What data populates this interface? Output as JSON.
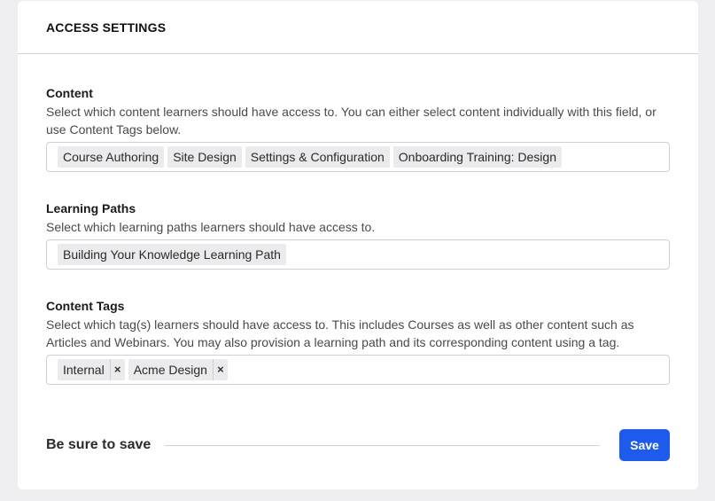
{
  "card": {
    "title": "ACCESS SETTINGS"
  },
  "content": {
    "title": "Content",
    "description": "Select which content learners should have access to. You can either select content individually with this field, or use Content Tags below.",
    "items": [
      "Course Authoring",
      "Site Design",
      "Settings & Configuration",
      "Onboarding Training: Design"
    ]
  },
  "learning_paths": {
    "title": "Learning Paths",
    "description": "Select which learning paths learners should have access to.",
    "items": [
      "Building Your Knowledge Learning Path"
    ]
  },
  "content_tags": {
    "title": "Content Tags",
    "description": "Select which tag(s) learners should have access to. This includes Courses as well as other content such as Articles and Webinars. You may also provision a learning path and its corresponding content using a tag.",
    "tags": [
      {
        "label": "Internal",
        "remove": "×"
      },
      {
        "label": "Acme Design",
        "remove": "×"
      }
    ]
  },
  "save": {
    "reminder": "Be sure to save",
    "button_label": "Save"
  },
  "colors": {
    "primary": "#1f5bea",
    "background": "#efeff1",
    "chip": "#ebebed"
  }
}
